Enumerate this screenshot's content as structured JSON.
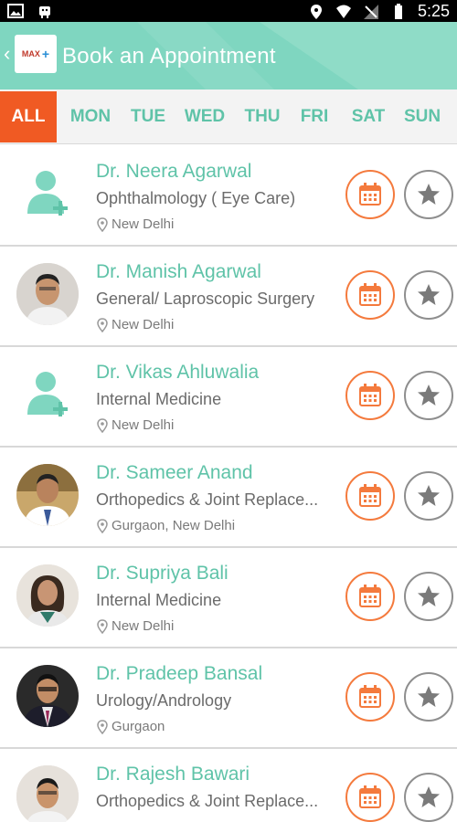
{
  "status_bar": {
    "time": "5:25"
  },
  "app_bar": {
    "title": "Book an Appointment",
    "logo_text": "MAX"
  },
  "tabs": [
    "ALL",
    "MON",
    "TUE",
    "WED",
    "THU",
    "FRI",
    "SAT",
    "SUN"
  ],
  "selected_tab": "ALL",
  "doctors": [
    {
      "name": "Dr. Neera Agarwal",
      "specialty": "Ophthalmology ( Eye Care)",
      "location": "New Delhi",
      "avatar": "placeholder"
    },
    {
      "name": "Dr. Manish Agarwal",
      "specialty": "General/ Laproscopic Surgery",
      "location": "New Delhi",
      "avatar": "photo"
    },
    {
      "name": "Dr. Vikas Ahluwalia",
      "specialty": "Internal Medicine",
      "location": "New Delhi",
      "avatar": "placeholder"
    },
    {
      "name": "Dr. Sameer Anand",
      "specialty": "Orthopedics & Joint Replace...",
      "location": "Gurgaon, New Delhi",
      "avatar": "photo"
    },
    {
      "name": "Dr. Supriya Bali",
      "specialty": "Internal Medicine",
      "location": "New Delhi",
      "avatar": "photo"
    },
    {
      "name": "Dr. Pradeep Bansal",
      "specialty": "Urology/Andrology",
      "location": "Gurgaon",
      "avatar": "photo"
    },
    {
      "name": "Dr. Rajesh Bawari",
      "specialty": "Orthopedics & Joint Replace...",
      "location": "",
      "avatar": "photo"
    }
  ],
  "colors": {
    "accent": "#5fc3a8",
    "appbar": "#7fd6c0",
    "active_tab": "#f05a23",
    "calendar": "#f47a3d",
    "star": "#8e8e8e"
  },
  "icons": {
    "calendar": "calendar-icon",
    "star": "star-icon",
    "location": "location-pin-icon",
    "doctor_placeholder": "doctor-placeholder-icon"
  }
}
